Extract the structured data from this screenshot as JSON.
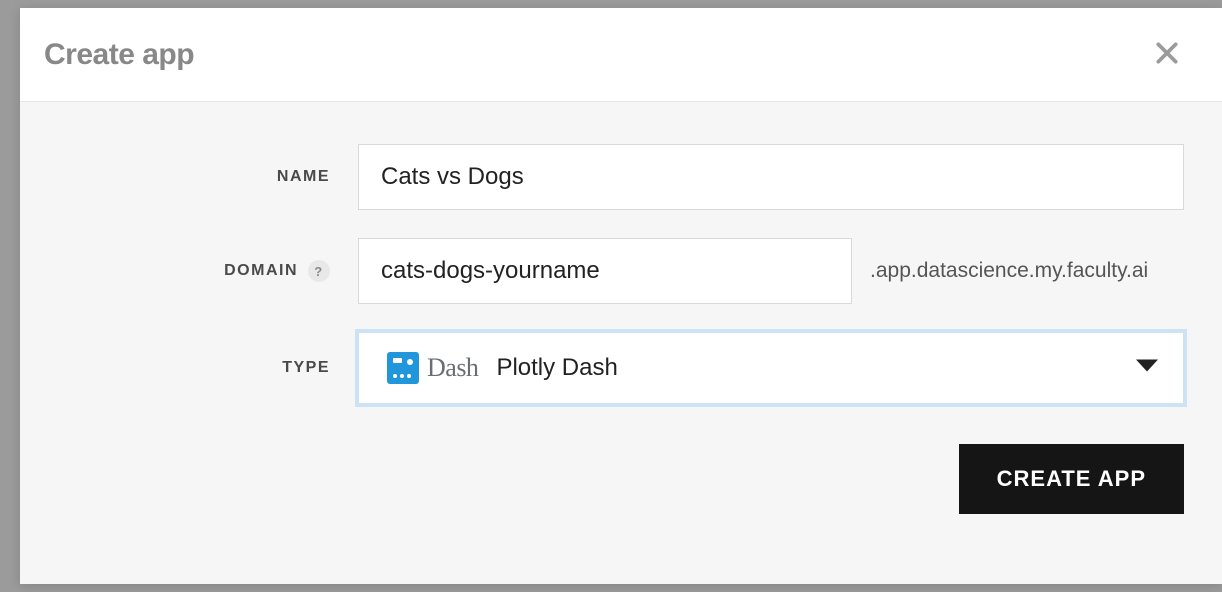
{
  "modal": {
    "title": "Create app",
    "close_label": "Close",
    "fields": {
      "name": {
        "label": "NAME",
        "value": "Cats vs Dogs"
      },
      "domain": {
        "label": "DOMAIN",
        "value": "cats-dogs-yourname",
        "suffix": ".app.datascience.my.faculty.ai",
        "help": "?"
      },
      "type": {
        "label": "TYPE",
        "wordmark": "Dash",
        "selected": "Plotly Dash"
      }
    },
    "submit_label": "CREATE APP"
  }
}
